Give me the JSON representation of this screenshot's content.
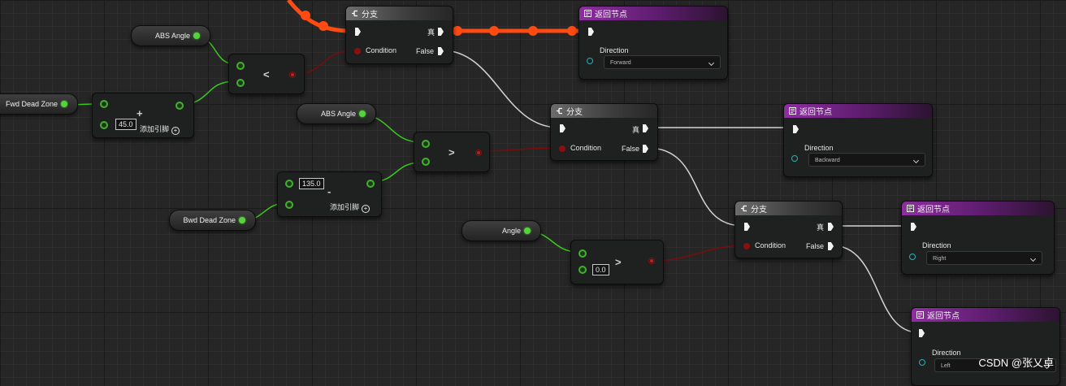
{
  "branch_title": "分支",
  "return_title": "返回节点",
  "true_label": "真",
  "false_label": "False",
  "condition_label": "Condition",
  "direction_label": "Direction",
  "add_pin_label": "添加引脚",
  "variables": {
    "abs_angle_1": "ABS Angle",
    "abs_angle_2": "ABS Angle",
    "fwd_dead_zone": "Fwd Dead Zone",
    "bwd_dead_zone": "Bwd Dead Zone",
    "angle": "Angle"
  },
  "operators": {
    "less": "<",
    "greater_1": ">",
    "greater_2": ">",
    "plus": "+",
    "minus": "-"
  },
  "values": {
    "add_default": "45.0",
    "sub_default": "135.0",
    "compare_default": "0.0"
  },
  "directions": {
    "forward": "Forward",
    "backward": "Backward",
    "right": "Right",
    "left": "Left"
  },
  "watermark": "CSDN @张乂卓",
  "colors": {
    "exec_active": "#ff4a12",
    "float_wire": "#3bc91e",
    "bool_wire": "#7a0c0c",
    "exec_wire": "#d4d4d4",
    "return_header": "#8e2ea0"
  }
}
